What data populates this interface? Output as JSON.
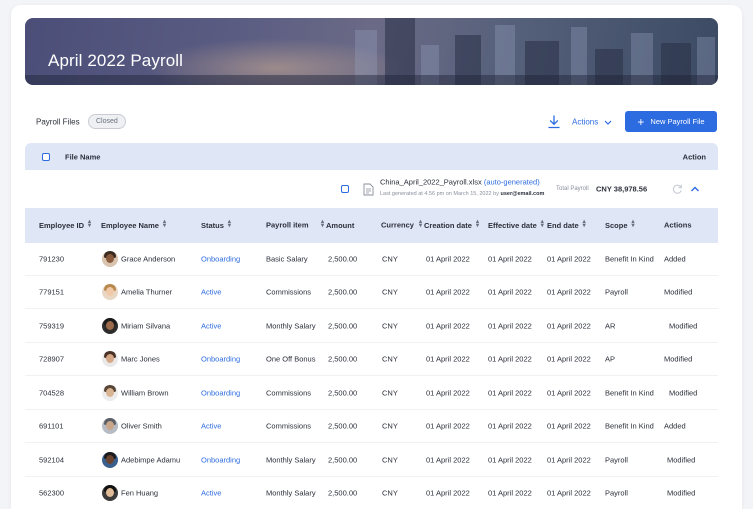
{
  "page": {
    "title": "April 2022 Payroll"
  },
  "toolbar": {
    "label": "Payroll Files",
    "badge": "Closed",
    "actions_label": "Actions",
    "new_button_label": "New Payroll File",
    "accent": "#2c6be0"
  },
  "file_table": {
    "header_name": "File Name",
    "header_action": "Action",
    "file": {
      "name": "China_April_2022_Payroll.xlsx",
      "tag": "(auto-generated)",
      "meta_prefix": "Last generated at 4.56 pm on March 15, 2022 by",
      "meta_user": "user@email.com",
      "total_label": "Total Payroll",
      "total_value": "CNY 38,978.56"
    }
  },
  "table": {
    "columns": [
      "Employee ID",
      "Employee Name",
      "Status",
      "Payroll item",
      "Amount",
      "Currency",
      "Creation date",
      "Effective date",
      "End date",
      "Scope",
      "Actions"
    ],
    "rows": [
      {
        "id": "791230",
        "name": "Grace Anderson",
        "status": "Onboarding",
        "item": "Basic Salary",
        "amount": "2,500.00",
        "currency": "CNY",
        "created": "01 April 2022",
        "effective": "01 April 2022",
        "end": "01 April 2022",
        "scope": "Benefit In Kind",
        "action": "Added"
      },
      {
        "id": "779151",
        "name": "Amelia Thurner",
        "status": "Active",
        "item": "Commissions",
        "amount": "2,500.00",
        "currency": "CNY",
        "created": "01 April 2022",
        "effective": "01 April 2022",
        "end": "01 April 2022",
        "scope": "Payroll",
        "action": "Modified"
      },
      {
        "id": "759319",
        "name": "Miriam Silvana",
        "status": "Active",
        "item": "Monthly Salary",
        "amount": "2,500.00",
        "currency": "CNY",
        "created": "01 April 2022",
        "effective": "01 April 2022",
        "end": "01 April 2022",
        "scope": "AR",
        "action": "Modified"
      },
      {
        "id": "728907",
        "name": "Marc Jones",
        "status": "Onboarding",
        "item": "One Off Bonus",
        "amount": "2,500.00",
        "currency": "CNY",
        "created": "01 April 2022",
        "effective": "01 April 2022",
        "end": "01 April 2022",
        "scope": "AP",
        "action": "Modified"
      },
      {
        "id": "704528",
        "name": "William Brown",
        "status": "Onboarding",
        "item": "Commissions",
        "amount": "2,500.00",
        "currency": "CNY",
        "created": "01 April 2022",
        "effective": "01 April 2022",
        "end": "01 April 2022",
        "scope": "Benefit In Kind",
        "action": "Modified"
      },
      {
        "id": "691101",
        "name": "Oliver Smith",
        "status": "Active",
        "item": "Commissions",
        "amount": "2,500.00",
        "currency": "CNY",
        "created": "01 April 2022",
        "effective": "01 April 2022",
        "end": "01 April 2022",
        "scope": "Benefit In Kind",
        "action": "Added"
      },
      {
        "id": "592104",
        "name": "Adebimpe Adamu",
        "status": "Onboarding",
        "item": "Monthly Salary",
        "amount": "2,500.00",
        "currency": "CNY",
        "created": "01 April 2022",
        "effective": "01 April 2022",
        "end": "01 April 2022",
        "scope": "Payroll",
        "action": "Modified"
      },
      {
        "id": "562300",
        "name": "Fen Huang",
        "status": "Active",
        "item": "Monthly Salary",
        "amount": "2,500.00",
        "currency": "CNY",
        "created": "01 April 2022",
        "effective": "01 April 2022",
        "end": "01 April 2022",
        "scope": "Payroll",
        "action": "Modified"
      }
    ]
  }
}
